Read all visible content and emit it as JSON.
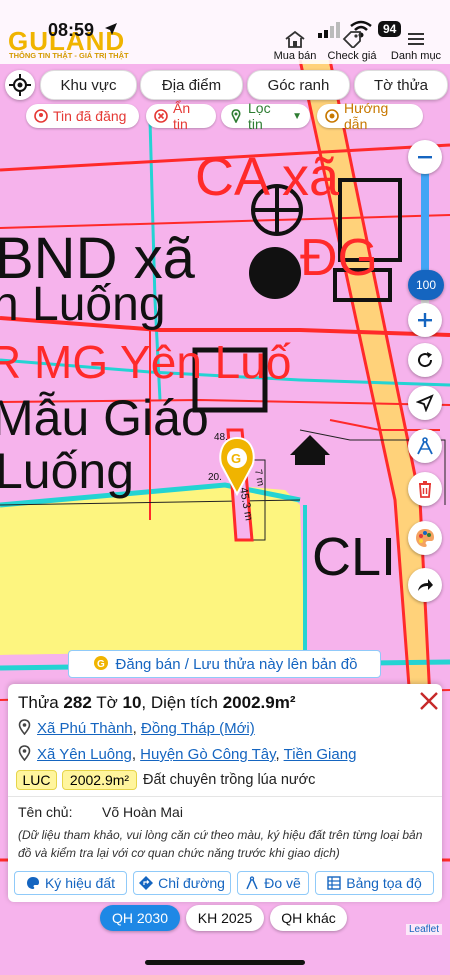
{
  "status_bar": {
    "time": "08:59",
    "battery": "94"
  },
  "header": {
    "logo": "GULAND",
    "tagline": "THÔNG TIN THẬT - GIÁ TRỊ THẬT",
    "nav": [
      {
        "label": "Mua bán",
        "icon": "house-icon"
      },
      {
        "label": "Check giá",
        "icon": "price-tag-icon"
      },
      {
        "label": "Danh mục",
        "icon": "menu-icon"
      }
    ]
  },
  "filters": {
    "pills": [
      "Khu vực",
      "Địa điểm",
      "Góc ranh",
      "Tờ thửa"
    ],
    "chips": [
      {
        "label": "Tin đã đăng",
        "color": "#e53935"
      },
      {
        "label": "Ẩn tin",
        "color": "#e53935"
      },
      {
        "label": "Lọc tin",
        "color": "#2e7d32"
      },
      {
        "label": "Hướng dẫn",
        "color": "#c77800"
      }
    ]
  },
  "map": {
    "zoom_level": "100",
    "labels": [
      "BND xã",
      "n Luống",
      "R MG Yên Luố",
      "Mẫu Giáo",
      "Luống",
      "CA xã",
      "ĐG",
      "CLI"
    ],
    "parcel_labels": [
      "48.",
      "20.",
      "45.3 m",
      "7 m"
    ],
    "attribution": "Leaflet",
    "colors": {
      "residential": "#f6b3ec",
      "rice": "#fdf57f",
      "road": "#ffd27a",
      "boundary": "#ff2a2a",
      "water": "#24d3d3"
    }
  },
  "save_banner": {
    "label": "Đăng bán / Lưu thửa này lên bản đồ"
  },
  "parcel": {
    "thua_label": "Thửa",
    "thua": "282",
    "to_label": "Tờ",
    "to": "10",
    "area_label": ", Diện tích",
    "area": "2002.9m²",
    "address_new": {
      "ward": "Xã Phú Thành",
      "province": "Đồng Tháp (Mới)"
    },
    "address_old": {
      "ward": "Xã Yên Luông",
      "district": "Huyện Gò Công Tây",
      "province": "Tiền Giang"
    },
    "land_code": "LUC",
    "land_area": "2002.9m²",
    "land_type": "Đất chuyên trồng lúa nước",
    "owner_label": "Tên chủ:",
    "owner": "Võ Hoàn Mai",
    "note": "(Dữ liệu tham khảo, vui lòng căn cứ theo màu, ký hiệu đất trên từng loại bản đồ và kiểm tra lại với cơ quan chức năng trước khi giao dịch)",
    "actions": [
      {
        "label": "Ký hiệu đất",
        "icon": "palette-icon"
      },
      {
        "label": "Chỉ đường",
        "icon": "directions-icon"
      },
      {
        "label": "Đo vẽ",
        "icon": "measure-icon"
      },
      {
        "label": "Bảng tọa độ",
        "icon": "table-icon"
      }
    ]
  },
  "plan_tabs": [
    {
      "label": "QH 2030",
      "active": true
    },
    {
      "label": "KH 2025",
      "active": false
    },
    {
      "label": "QH khác",
      "active": false
    }
  ]
}
